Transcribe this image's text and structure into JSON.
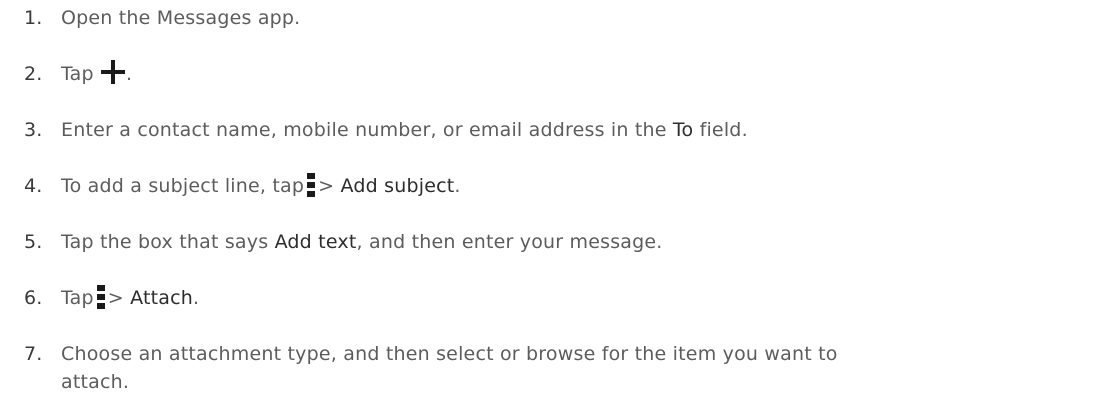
{
  "steps": [
    {
      "number": "1.",
      "text": "Open the Messages app."
    },
    {
      "number": "2.",
      "before": "Tap",
      "icon": "plus-icon",
      "after": "."
    },
    {
      "number": "3.",
      "before": "Enter a contact name, mobile number, or email address in the ",
      "ui": "To",
      "after": " field."
    },
    {
      "number": "4.",
      "before": "To add a subject line, tap",
      "icon": "more-vertical-icon",
      "sep": "> ",
      "ui": "Add subject",
      "after": "."
    },
    {
      "number": "5.",
      "before": "Tap the box that says ",
      "ui": "Add text",
      "after": ", and then enter your message."
    },
    {
      "number": "6.",
      "before": "Tap",
      "icon": "more-vertical-icon",
      "sep": "> ",
      "ui": "Attach",
      "after": "."
    },
    {
      "number": "7.",
      "line1": "Choose an attachment type, and then select or browse for the item you want to",
      "line2": "attach."
    }
  ],
  "colors": {
    "text": "#5c5c5c",
    "ui_text": "#2c2c2c",
    "icon": "#1a1a1a"
  }
}
